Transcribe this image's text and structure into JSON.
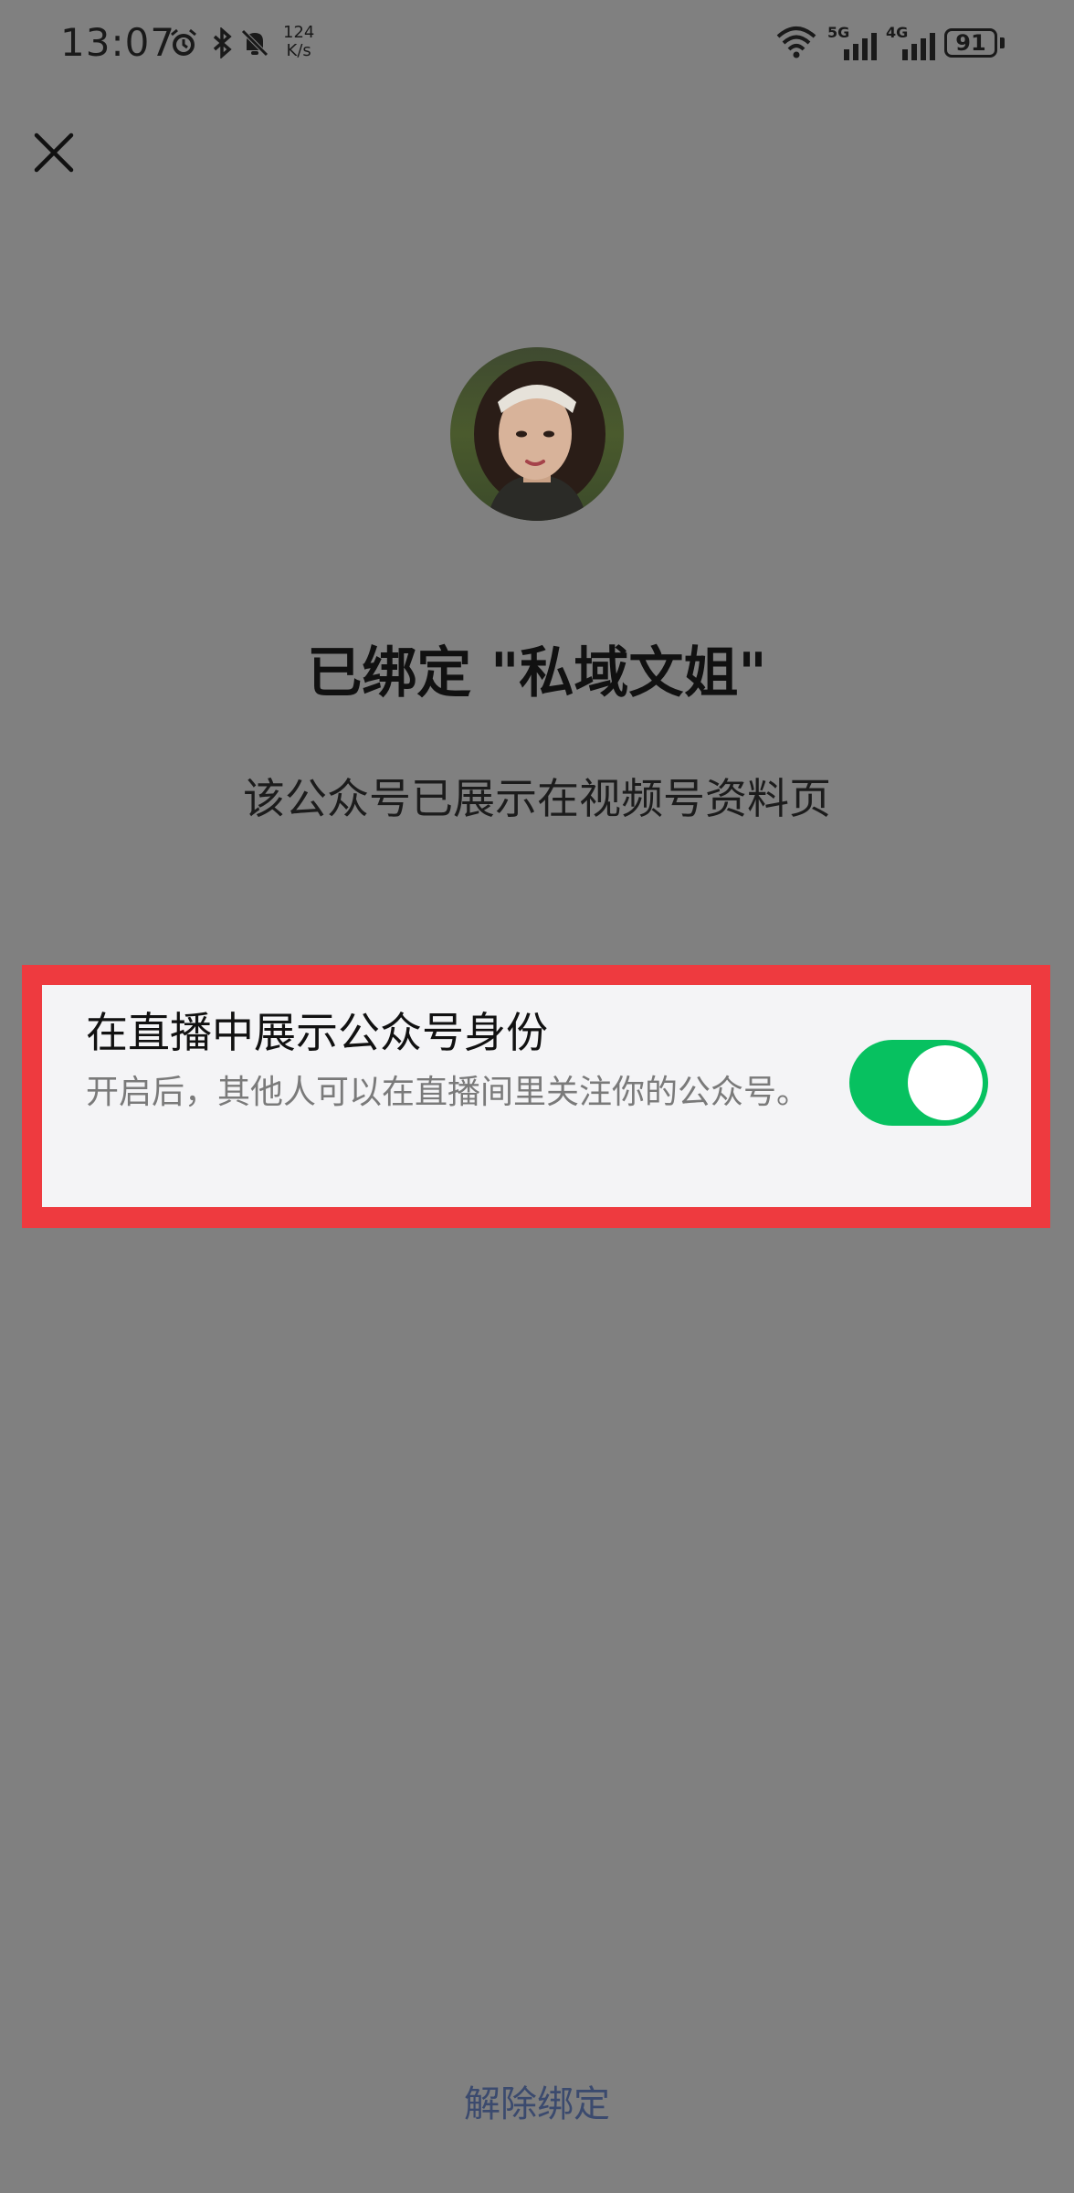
{
  "status_bar": {
    "time": "13:07",
    "net_speed_value": "124",
    "net_speed_unit": "K/s",
    "signal_1_label": "5G",
    "signal_2_label": "4G",
    "battery": "91",
    "icons": [
      "alarm-icon",
      "bluetooth-icon",
      "mute-bell-icon",
      "wifi-icon",
      "signal-icon",
      "battery-icon"
    ]
  },
  "header": {
    "close_icon": "close-icon"
  },
  "profile": {
    "title": "已绑定 \"私域文姐\"",
    "subtitle": "该公众号已展示在视频号资料页"
  },
  "setting": {
    "title": "在直播中展示公众号身份",
    "description": "开启后，其他人可以在直播间里关注你的公众号。",
    "toggle_on": true,
    "toggle_color": "#07c160",
    "highlight_color": "#ee3a3f"
  },
  "footer": {
    "unbind_label": "解除绑定"
  }
}
